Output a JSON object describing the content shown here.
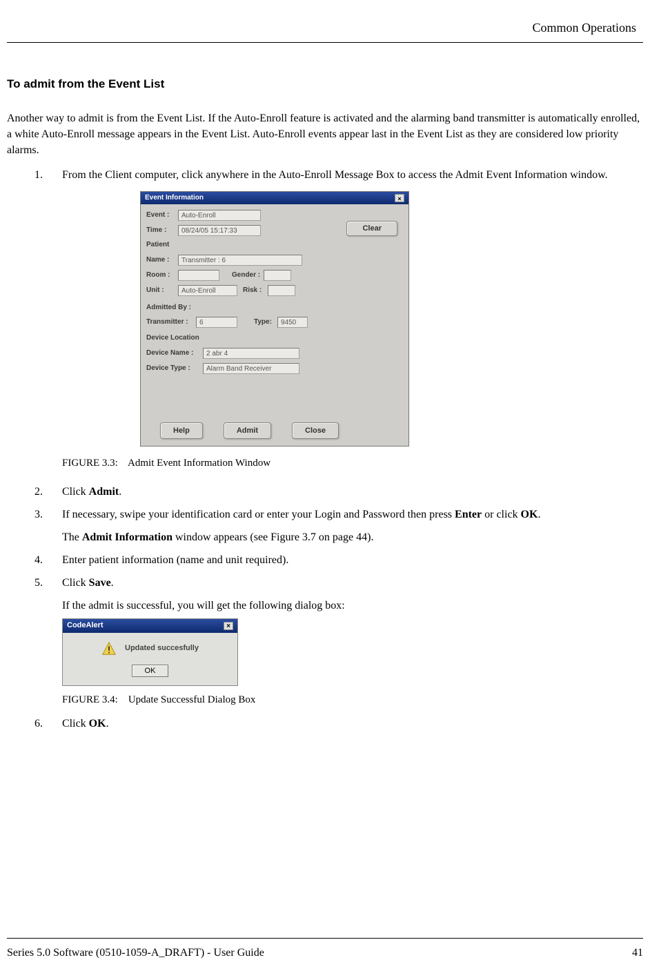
{
  "header_right": "Common Operations",
  "section_title": "To admit from the Event List",
  "intro_para": "Another way to admit is from the Event List. If the Auto-Enroll feature is activated and the alarming band transmitter is automatically enrolled, a white Auto-Enroll message appears in the Event List. Auto-Enroll events appear last in the Event List as they are considered low priority alarms.",
  "steps": {
    "s1": {
      "num": "1.",
      "text": "From the Client computer, click anywhere in the Auto-Enroll Message Box to access the Admit Event Information window."
    },
    "s2": {
      "num": "2.",
      "pre": "Click ",
      "bold": "Admit",
      "post": "."
    },
    "s3": {
      "num": "3.",
      "pre": "If necessary, swipe your identification card or enter your Login and Password then press ",
      "bold1": "Enter",
      "mid": " or click ",
      "bold2": "OK",
      "post": ".",
      "sub_pre": "The ",
      "sub_bold": "Admit Information",
      "sub_post": " window appears (see Figure 3.7 on page 44)."
    },
    "s4": {
      "num": "4.",
      "text": "Enter patient information (name and unit required)."
    },
    "s5": {
      "num": "5.",
      "pre": "Click ",
      "bold": "Save",
      "post": ".",
      "sub": "If the admit is successful, you will get the following dialog box:"
    },
    "s6": {
      "num": "6.",
      "pre": "Click ",
      "bold": "OK",
      "post": "."
    }
  },
  "fig1_caption_label": "FIGURE 3.3:",
  "fig1_caption_text": "Admit Event Information Window",
  "fig2_caption_label": "FIGURE 3.4:",
  "fig2_caption_text": "Update Successful Dialog Box",
  "dlg1": {
    "title": "Event Information",
    "event_lbl": "Event :",
    "event_val": "Auto-Enroll",
    "time_lbl": "Time :",
    "time_val": "08/24/05 15:17:33",
    "clear_btn": "Clear",
    "patient_sect": "Patient",
    "name_lbl": "Name :",
    "name_val": "Transmitter : 6",
    "room_lbl": "Room :",
    "room_val": "",
    "gender_lbl": "Gender :",
    "gender_val": "",
    "unit_lbl": "Unit :",
    "unit_val": "Auto-Enroll",
    "risk_lbl": "Risk :",
    "risk_val": "",
    "admitted_sect": "Admitted By :",
    "transmitter_lbl": "Transmitter :",
    "transmitter_val": "6",
    "type_lbl": "Type:",
    "type_val": "9450",
    "dev_loc_sect": "Device Location",
    "dev_name_lbl": "Device Name :",
    "dev_name_val": "2 abr 4",
    "dev_type_lbl": "Device Type :",
    "dev_type_val": "Alarm Band Receiver",
    "help_btn": "Help",
    "admit_btn": "Admit",
    "close_btn": "Close"
  },
  "dlg2": {
    "title": "CodeAlert",
    "msg": "Updated succesfully",
    "ok_btn": "OK"
  },
  "footer_left": "Series 5.0 Software (0510-1059-A_DRAFT) - User Guide",
  "footer_right": "41"
}
